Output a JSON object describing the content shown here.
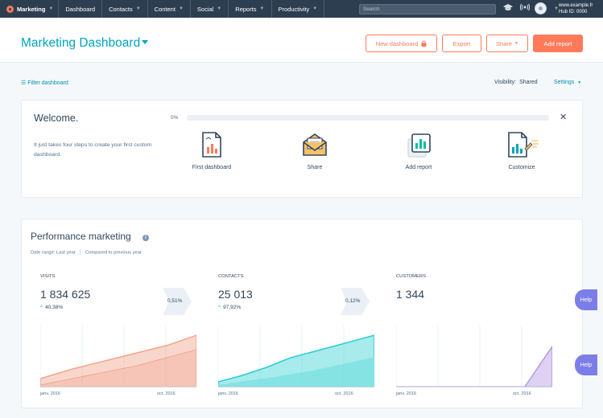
{
  "nav": {
    "brand": "Marketing",
    "items": [
      {
        "label": "Dashboard",
        "caret": false
      },
      {
        "label": "Contacts",
        "caret": true
      },
      {
        "label": "Content",
        "caret": true
      },
      {
        "label": "Social",
        "caret": true
      },
      {
        "label": "Reports",
        "caret": true
      },
      {
        "label": "Productivity",
        "caret": true
      }
    ],
    "search_placeholder": "Search",
    "account_domain": "www.example.fr",
    "hub_id": "Hub ID: 0000",
    "icons": [
      "graduation-cap-icon",
      "notification-icon",
      "avatar-icon"
    ]
  },
  "header": {
    "title": "Marketing Dashboard",
    "new_dashboard": "New dashboard",
    "export": "Export",
    "share": "Share",
    "add_report": "Add report"
  },
  "filter": {
    "label": "Filter dashboard",
    "visibility_label": "Visibility:",
    "visibility_value": "Shared",
    "settings": "Settings"
  },
  "welcome": {
    "title": "Welcome.",
    "text": "It just takes four steps to create your first custom dashboard.",
    "progress_label": "0%",
    "progress_value": 0,
    "steps": [
      {
        "label": "First dashboard",
        "icon": "report-document-icon"
      },
      {
        "label": "Share",
        "icon": "envelope-icon"
      },
      {
        "label": "Add report",
        "icon": "bar-chart-card-icon"
      },
      {
        "label": "Customize",
        "icon": "customize-document-icon"
      }
    ]
  },
  "performance": {
    "title": "Performance marketing",
    "date_range": "Date range: Last year",
    "compared": "Compared to previous year",
    "kpis": [
      {
        "label": "VISITS",
        "value": "1 834 625",
        "delta": "40,38%",
        "conversion": "0,51%",
        "color": "#f2a58e"
      },
      {
        "label": "CONTACTS",
        "value": "25 013",
        "delta": "97,92%",
        "conversion": "0,12%",
        "color": "#5fdadc"
      },
      {
        "label": "CUSTOMERS",
        "value": "1 344",
        "delta": "",
        "conversion": "",
        "color": "#c8b3ec"
      }
    ],
    "x_start": "janv. 2016",
    "x_end": "oct. 2016"
  },
  "help": "Help"
}
